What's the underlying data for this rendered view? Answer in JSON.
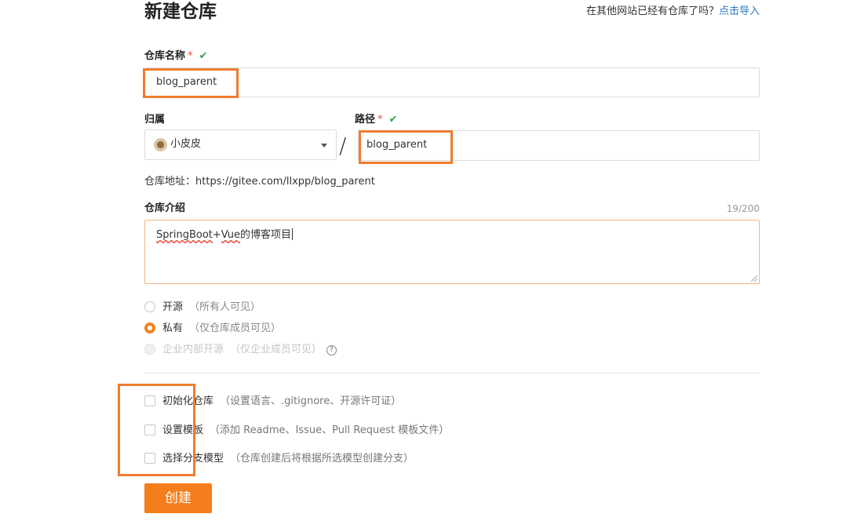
{
  "header": {
    "title": "新建仓库",
    "import_prompt": "在其他网站已经有仓库了吗？",
    "import_link": "点击导入"
  },
  "repo_name": {
    "label": "仓库名称",
    "required_mark": "*",
    "valid_icon": "check-icon",
    "value": "blog_parent"
  },
  "owner": {
    "label": "归属",
    "value": "小皮皮",
    "avatar_icon": "user-avatar"
  },
  "separator": "/",
  "path": {
    "label": "路径",
    "required_mark": "*",
    "valid_icon": "check-icon",
    "value": "blog_parent"
  },
  "repo_url": {
    "label": "仓库地址：",
    "value": "https://gitee.com/llxpp/blog_parent"
  },
  "description": {
    "label": "仓库介绍",
    "counter": "19/200",
    "value_part1": "SpringBoot",
    "value_part2": "+",
    "value_part3": "Vue",
    "value_part4": "的博客项目"
  },
  "visibility": {
    "options": [
      {
        "label": "开源",
        "note": "（所有人可见）",
        "checked": false,
        "disabled": false
      },
      {
        "label": "私有",
        "note": "（仅仓库成员可见）",
        "checked": true,
        "disabled": false
      },
      {
        "label": "企业内部开源",
        "note": "（仅企业成员可见）",
        "checked": false,
        "disabled": true
      }
    ]
  },
  "init_options": [
    {
      "label": "初始化仓库",
      "note": "（设置语言、.gitignore、开源许可证）",
      "checked": false
    },
    {
      "label": "设置模板",
      "note": "（添加 Readme、Issue、Pull Request 模板文件）",
      "checked": false
    },
    {
      "label": "选择分支模型",
      "note": "（仓库创建后将根据所选模型创建分支）",
      "checked": false
    }
  ],
  "submit": {
    "label": "创建"
  },
  "colors": {
    "accent": "#f47d1c",
    "highlight": "#ef7d30",
    "link": "#2f78c4",
    "valid": "#2fa44f",
    "required": "#e94b3c"
  }
}
